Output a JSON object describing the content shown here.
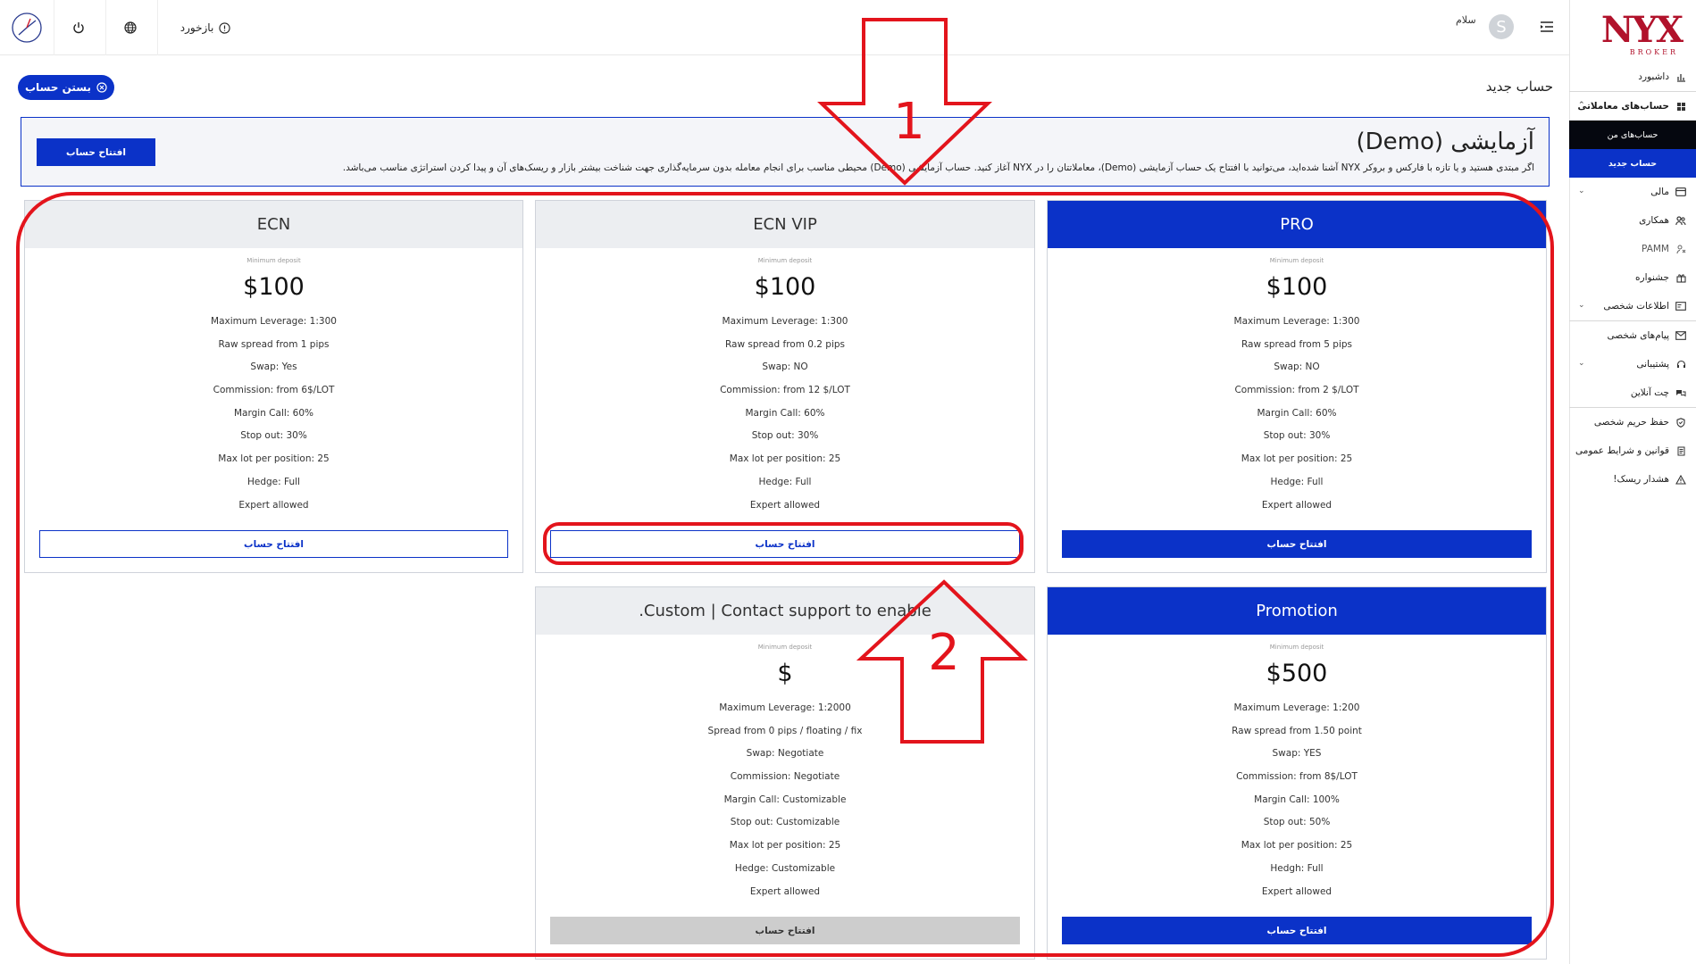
{
  "sidebar": {
    "logo": {
      "main": "NYX",
      "sub": "BROKER"
    },
    "items": [
      {
        "label": "داشبورد",
        "icon": "bar-chart-icon"
      },
      {
        "label": "حساب‌های معاملاتی",
        "icon": "grid-icon",
        "expanded": true
      },
      {
        "label": "مالی",
        "icon": "card-icon"
      },
      {
        "label": "همکاری",
        "icon": "people-icon"
      },
      {
        "label": "PAMM",
        "icon": "user-link-icon"
      },
      {
        "label": "جشنواره",
        "icon": "gift-icon"
      },
      {
        "label": "اطلاعات شخصی",
        "icon": "id-card-icon"
      },
      {
        "label": "پیام‌های شخصی",
        "icon": "mail-icon"
      },
      {
        "label": "پشتیبانی",
        "icon": "headset-icon"
      },
      {
        "label": "چت آنلاین",
        "icon": "chat-icon"
      },
      {
        "label": "حفظ حریم شخصی",
        "icon": "shield-icon"
      },
      {
        "label": "قوانین و شرایط عمومی",
        "icon": "rules-icon"
      },
      {
        "label": "هشدار ریسک!",
        "icon": "warning-icon"
      }
    ],
    "sub_items": [
      {
        "label": "حساب‌های من"
      },
      {
        "label": "حساب جدید"
      }
    ]
  },
  "topbar": {
    "feedback_label": "بازخورد",
    "greeting": "سلام",
    "avatar_letter": "S"
  },
  "page": {
    "title": "حساب جدید",
    "close_button": "بستن حساب"
  },
  "demo": {
    "title": "آزمایشی (Demo)",
    "description": "اگر مبتدی هستید و یا تازه با فارکس و بروکر NYX آشنا شده‌اید، می‌توانید با افتتاح یک حساب آزمایشی (Demo)، معاملاتتان را در NYX آغاز کنید. حساب آزمایشی (Demo) محیطی مناسب برای انجام معامله بدون سرمایه‌گذاری جهت شناخت بیشتر بازار و ریسک‌های آن و پیدا کردن استراتژی مناسب می‌باشد.",
    "button": "افتتاح حساب"
  },
  "cards": [
    {
      "name": "PRO",
      "highlight": true,
      "min_label": "Minimum deposit",
      "price": "$100",
      "features": [
        "Maximum Leverage: 1:300",
        "Raw spread from 5 pips",
        "Swap: NO",
        "Commission: from 2 $/LOT",
        "Margin Call: 60%",
        "Stop out: 30%",
        "Max lot per position: 25",
        "Hedge: Full",
        "Expert allowed"
      ],
      "button": "افتتاح حساب",
      "button_style": "solid"
    },
    {
      "name": "ECN VIP",
      "highlight": false,
      "min_label": "Minimum deposit",
      "price": "$100",
      "features": [
        "Maximum Leverage: 1:300",
        "Raw spread from 0.2 pips",
        "Swap: NO",
        "Commission: from 12 $/LOT",
        "Margin Call: 60%",
        "Stop out: 30%",
        "Max lot per position: 25",
        "Hedge: Full",
        "Expert allowed"
      ],
      "button": "افتتاح حساب",
      "button_style": "outline"
    },
    {
      "name": "ECN",
      "highlight": false,
      "min_label": "Minimum deposit",
      "price": "$100",
      "features": [
        "Maximum Leverage: 1:300",
        "Raw spread from 1 pips",
        "Swap: Yes",
        "Commission: from 6$/LOT",
        "Margin Call: 60%",
        "Stop out: 30%",
        "Max lot per position: 25",
        "Hedge: Full",
        "Expert allowed"
      ],
      "button": "افتتاح حساب",
      "button_style": "outline"
    },
    {
      "name": "Promotion",
      "highlight": true,
      "min_label": "Minimum deposit",
      "price": "$500",
      "features": [
        "Maximum Leverage: 1:200",
        "Raw spread from 1.50 point",
        "Swap: YES",
        "Commission: from 8$/LOT",
        "Margin Call: 100%",
        "Stop out: 50%",
        "Max lot per position: 25",
        "Hedgh: Full",
        "Expert allowed"
      ],
      "button": "افتتاح حساب",
      "button_style": "solid"
    },
    {
      "name": ".Custom | Contact support to enable",
      "highlight": false,
      "min_label": "Minimum deposit",
      "price": "$",
      "features": [
        "Maximum Leverage: 1:2000",
        "Spread from 0 pips / floating / fix",
        "Swap: Negotiate",
        "Commission: Negotiate",
        "Margin Call: Customizable",
        "Stop out: Customizable",
        "Max lot per position: 25",
        "Hedge: Customizable",
        "Expert allowed"
      ],
      "button": "افتتاح حساب",
      "button_style": "disabled"
    }
  ],
  "annotations": {
    "label_1": "1",
    "label_2": "2",
    "color": "#e3141c"
  }
}
